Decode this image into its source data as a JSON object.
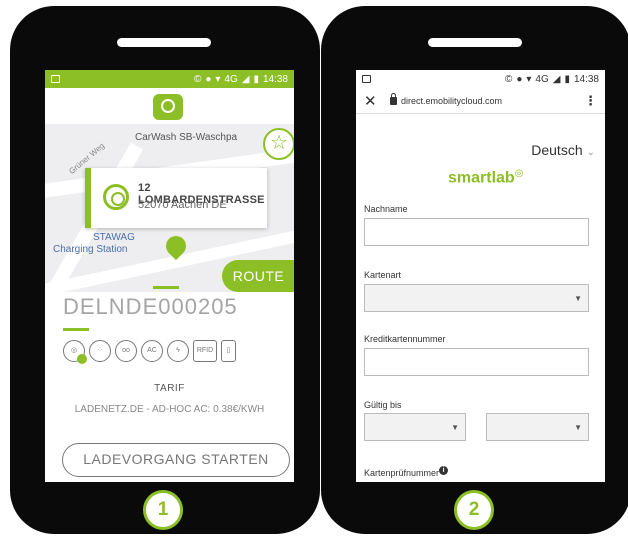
{
  "phone1": {
    "statusbar": {
      "time": "14:38",
      "network": "4G",
      "icons": [
        "image-icon",
        "circle-c-icon",
        "minus-circle-icon",
        "wifi-icon",
        "signal-icon",
        "battery-icon"
      ]
    },
    "map": {
      "streets": [
        "Grüner Weg"
      ],
      "poi_carwash": "CarWash SB-Waschpa",
      "poi_station_line1": "STAWAG",
      "poi_station_line2": "Charging Station"
    },
    "address": {
      "title": "12 LOMBARDENSTRASSE",
      "city": "52070 Aachen DE"
    },
    "route_label": "ROUTE",
    "station_id": "DELNDE000205",
    "connector_icons": [
      "type2-icon",
      "ccs-icon",
      "chademo-icon",
      "ac-icon",
      "fast-charge-icon",
      "rfid-icon",
      "app-icon"
    ],
    "connector_texts": {
      "ac": "AC",
      "rfid": "RFID"
    },
    "tarif_label": "TARIF",
    "tarif_value": "LADENETZ.DE - AD-HOC AC: 0.38€/KWH",
    "start_button": "LADEVORGANG STARTEN",
    "step": "1"
  },
  "phone2": {
    "statusbar": {
      "time": "14:38",
      "network": "4G"
    },
    "browser": {
      "url": "direct.emobilitycloud.com"
    },
    "language": "Deutsch",
    "brand": {
      "text": "smartlab",
      "sup": "◎"
    },
    "fields": {
      "nachname": "Nachname",
      "kartenart": "Kartenart",
      "kreditkartennummer": "Kreditkartennummer",
      "gueltig_bis": "Gültig bis",
      "kartenpruefnummer": "Kartenprüfnummer"
    },
    "step": "2"
  },
  "colors": {
    "accent": "#8cbf26",
    "phone_body": "#0a0a0a"
  }
}
